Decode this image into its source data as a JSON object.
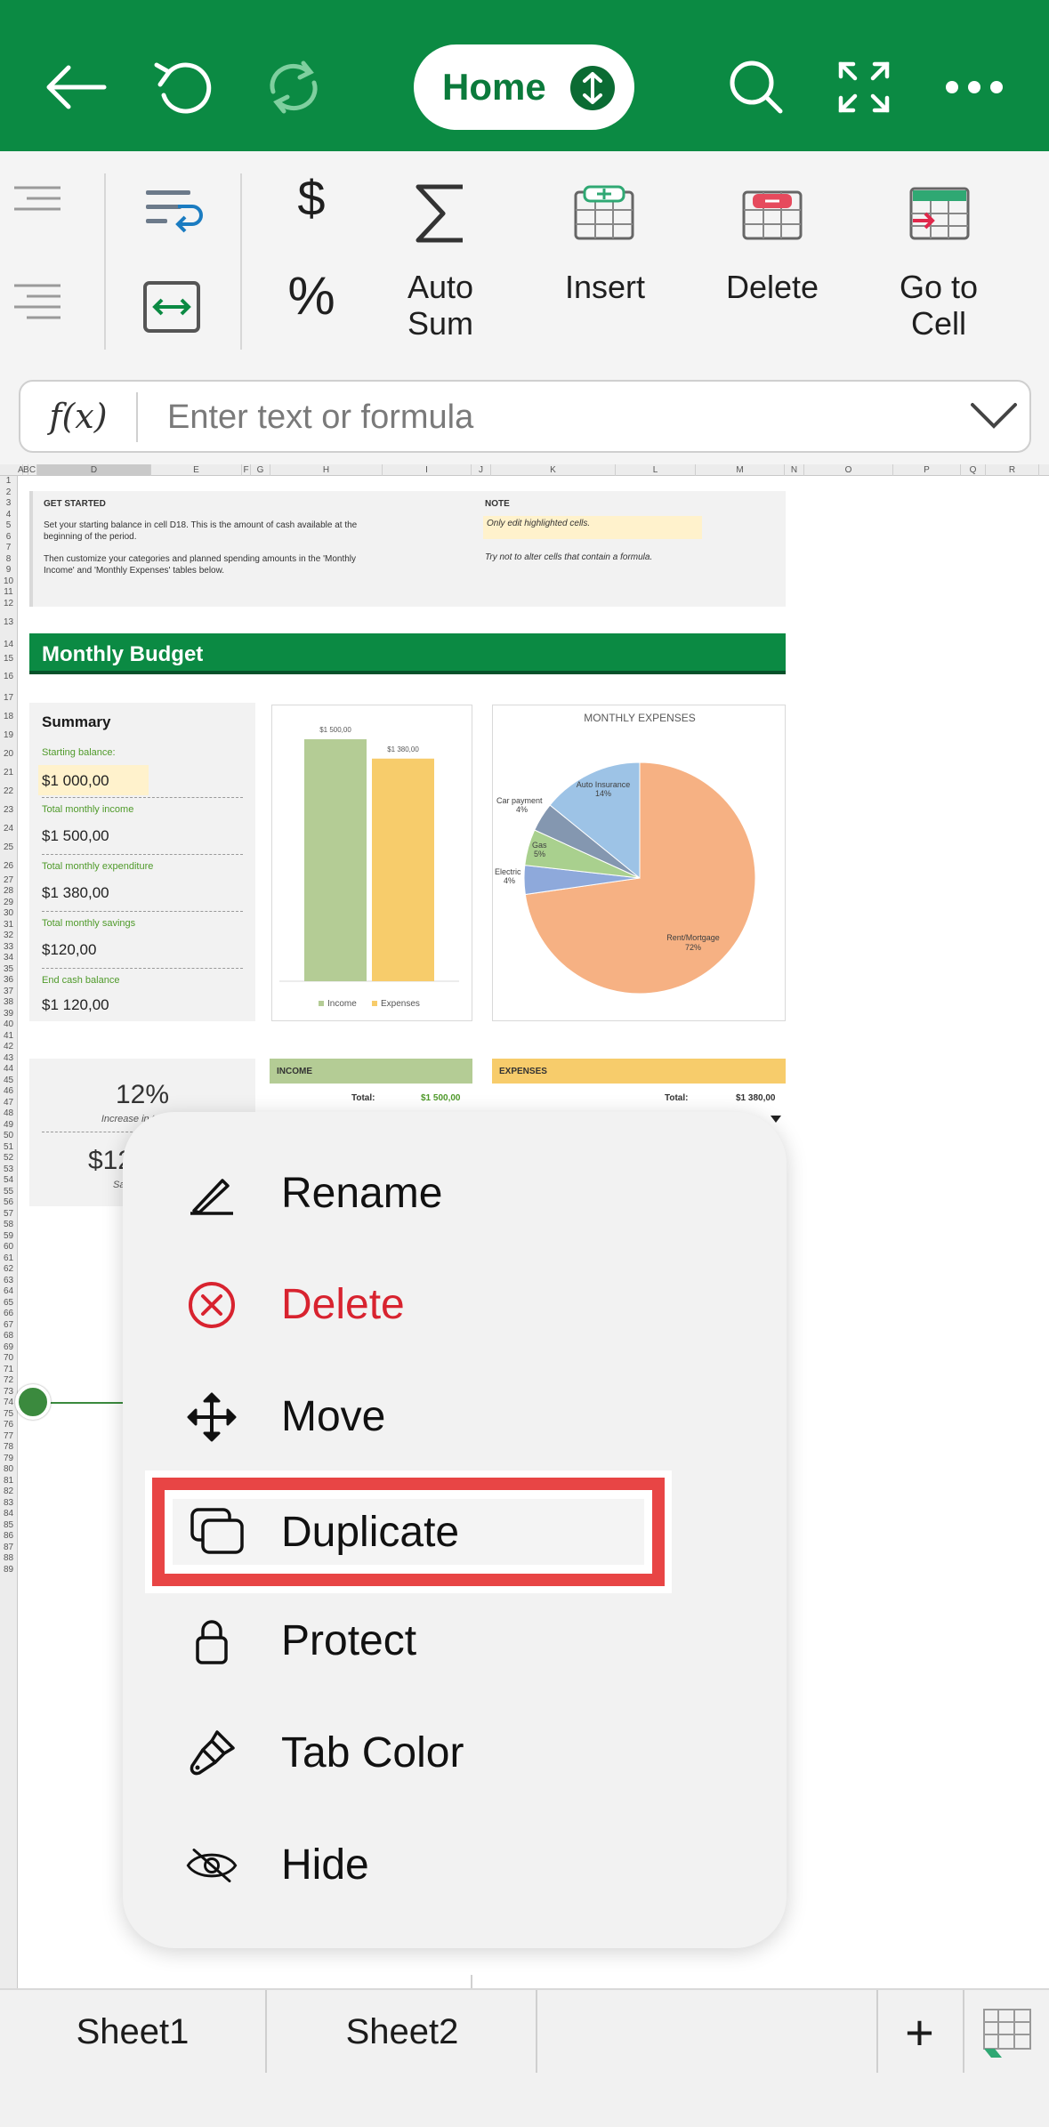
{
  "topbar": {
    "home_label": "Home",
    "icons": [
      "back-arrow-icon",
      "undo-icon",
      "redo-icon",
      "search-icon",
      "fullscreen-icon",
      "more-icon"
    ]
  },
  "ribbon": {
    "currency_symbol": "$",
    "percent_symbol": "%",
    "autosum_line1": "Auto",
    "autosum_line2": "Sum",
    "insert_label": "Insert",
    "delete_label": "Delete",
    "goto_line1": "Go to",
    "goto_line2": "Cell"
  },
  "formula_bar": {
    "fx_label": "f(x)",
    "placeholder": "Enter text or formula"
  },
  "grid": {
    "columns": [
      "A",
      "B",
      "C",
      "D",
      "E",
      "F",
      "G",
      "H",
      "I",
      "J",
      "K",
      "L",
      "M",
      "N",
      "O",
      "P",
      "Q",
      "R"
    ],
    "rows": [
      "1",
      "2",
      "3",
      "4",
      "5",
      "6",
      "7",
      "8",
      "9",
      "10",
      "11",
      "12",
      "13",
      "14",
      "15",
      "16",
      "17",
      "18",
      "19",
      "20",
      "21",
      "22",
      "23",
      "24",
      "25",
      "26",
      "27",
      "28",
      "29",
      "30",
      "31",
      "32",
      "33",
      "34",
      "35",
      "36",
      "37",
      "38",
      "39",
      "40",
      "41",
      "42",
      "43",
      "44",
      "45",
      "46",
      "47",
      "48",
      "49",
      "50",
      "51",
      "52",
      "53",
      "54",
      "55",
      "56",
      "57",
      "58",
      "59",
      "60",
      "61",
      "62",
      "63",
      "64",
      "65",
      "66",
      "67",
      "68",
      "69",
      "70",
      "71",
      "72",
      "73",
      "74",
      "75",
      "76",
      "77",
      "78",
      "79",
      "80",
      "81",
      "82",
      "83",
      "84",
      "85",
      "86",
      "87",
      "88",
      "89"
    ]
  },
  "sheet": {
    "get_started_title": "GET STARTED",
    "get_started_p1": "Set your starting balance in cell D18. This is the amount of cash available at the beginning of the period.",
    "get_started_p2": "Then customize your categories and planned spending amounts in the 'Monthly Income' and 'Monthly Expenses' tables below.",
    "note_title": "NOTE",
    "note_line1": "Only edit highlighted cells.",
    "note_line2": "Try not to alter cells that contain a formula.",
    "banner_title": "Monthly Budget",
    "summary_title": "Summary",
    "starting_balance_label": "Starting balance:",
    "starting_balance_value": "$1 000,00",
    "total_income_label": "Total monthly income",
    "total_income_value": "$1 500,00",
    "total_expenditure_label": "Total monthly expenditure",
    "total_expenditure_value": "$1 380,00",
    "total_savings_label": "Total monthly savings",
    "total_savings_value": "$120,00",
    "end_balance_label": "End cash balance",
    "end_balance_value": "$1 120,00",
    "savings_pct": "12%",
    "savings_pct_label": "Increase in total sa",
    "savings_amount": "$12",
    "savings_amount_label": "Sav",
    "income_header": "INCOME",
    "income_total_label": "Total:",
    "income_total_value": "$1 500,00",
    "expenses_header": "EXPENSES",
    "expenses_total_label": "Total:",
    "expenses_total_value": "$1 380,00",
    "expenses_partial": "00",
    "income_color": "#b4cc95",
    "expenses_color": "#f7cc6b",
    "banner_color": "#0b8a43"
  },
  "chart_data": [
    {
      "type": "bar",
      "categories": [
        "Income",
        "Expenses"
      ],
      "values": [
        1500,
        1380
      ],
      "data_labels": [
        "$1 500,00",
        "$1 380,00"
      ],
      "legend": [
        "Income",
        "Expenses"
      ],
      "colors": [
        "#b4cc95",
        "#f7cc6b"
      ],
      "legend_position": "bottom"
    },
    {
      "type": "pie",
      "title": "MONTHLY EXPENSES",
      "slices": [
        {
          "label": "Rent/Mortgage",
          "pct_label": "72%",
          "value": 72,
          "color": "#f6b183"
        },
        {
          "label": "Electric",
          "pct_label": "4%",
          "value": 4,
          "color": "#8ea9db"
        },
        {
          "label": "Gas",
          "pct_label": "5%",
          "value": 5,
          "color": "#a9d08e"
        },
        {
          "label": "Car payment",
          "pct_label": "4%",
          "value": 4,
          "color": "#8497b0"
        },
        {
          "label": "Auto Insurance",
          "pct_label": "14%",
          "value": 14,
          "color": "#9dc3e6"
        }
      ]
    }
  ],
  "context_menu": {
    "items": [
      {
        "name": "rename",
        "label": "Rename",
        "icon": "pencil-icon"
      },
      {
        "name": "delete",
        "label": "Delete",
        "icon": "circle-x-icon"
      },
      {
        "name": "move",
        "label": "Move",
        "icon": "move-arrows-icon"
      },
      {
        "name": "duplicate",
        "label": "Duplicate",
        "icon": "duplicate-icon"
      },
      {
        "name": "protect",
        "label": "Protect",
        "icon": "lock-icon"
      },
      {
        "name": "tab-color",
        "label": "Tab Color",
        "icon": "paintbrush-icon"
      },
      {
        "name": "hide",
        "label": "Hide",
        "icon": "eye-slash-icon"
      }
    ],
    "delete_color": "#d8232f",
    "highlight_color": "#e84545"
  },
  "tabs": {
    "sheet1": "Sheet1",
    "sheet2": "Sheet2",
    "add_symbol": "+"
  }
}
